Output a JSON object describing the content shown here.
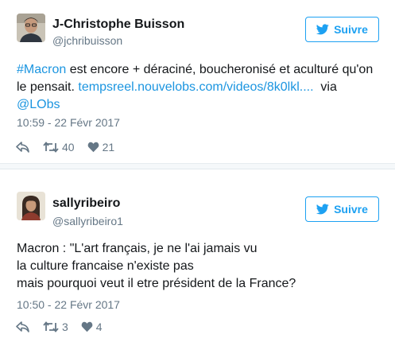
{
  "tweets": [
    {
      "name": "J-Christophe Buisson",
      "handle": "@jchribuisson",
      "follow_label": "Suivre",
      "text_lines": [
        [
          {
            "text": "#Macron",
            "link": true
          },
          {
            "text": " est encore + déraciné, boucheronisé et aculturé qu'on",
            "link": false
          }
        ],
        [
          {
            "text": "le pensait. ",
            "link": false
          },
          {
            "text": "tempsreel.nouvelobs.com/videos/8k0lkl....",
            "link": true
          },
          {
            "text": "  via",
            "link": false
          }
        ],
        [
          {
            "text": "@LObs",
            "link": true
          }
        ]
      ],
      "timestamp": "10:59 - 22 Févr 2017",
      "retweets": "40",
      "likes": "21"
    },
    {
      "name": "sallyribeiro",
      "handle": "@sallyribeiro1",
      "follow_label": "Suivre",
      "text_lines": [
        [
          {
            "text": "Macron : \"L'art français, je ne l'ai jamais vu",
            "link": false
          }
        ],
        [
          {
            "text": "la culture francaise n'existe pas",
            "link": false
          }
        ],
        [
          {
            "text": "mais pourquoi veut il etre président de la France?",
            "link": false
          }
        ]
      ],
      "timestamp": "10:50 - 22 Févr 2017",
      "retweets": "3",
      "likes": "4"
    }
  ],
  "colors": {
    "link": "#1b95e0",
    "follow": "#1da1f2",
    "meta": "#657786",
    "text": "#14171a"
  },
  "icons": {
    "follow": "twitter-bird-icon",
    "reply": "reply-icon",
    "retweet": "retweet-icon",
    "like": "heart-icon"
  }
}
